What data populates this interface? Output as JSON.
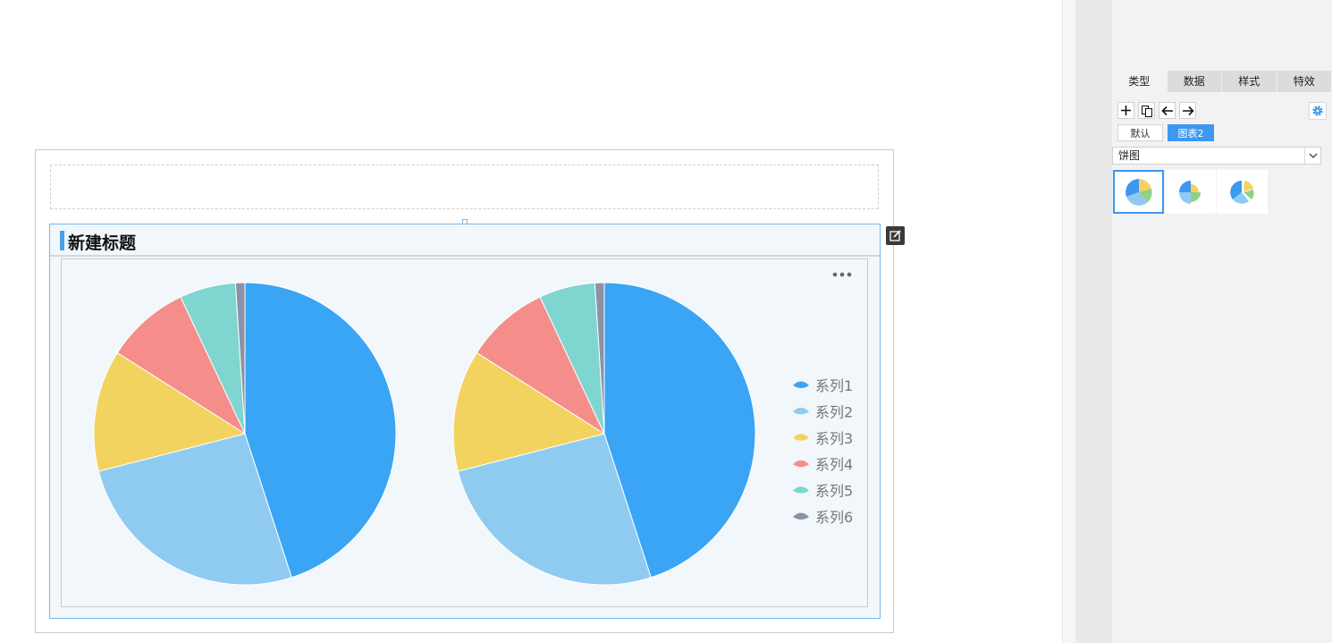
{
  "widget": {
    "title": "新建标题"
  },
  "panel": {
    "tabs": [
      "类型",
      "数据",
      "样式",
      "特效"
    ],
    "active_tab": "类型",
    "chips": {
      "default": "默认",
      "chart2": "图表2"
    },
    "select_value": "饼图",
    "accent_color": "#3c98f0"
  },
  "chart_data": {
    "type": "pie",
    "pies": [
      {
        "values": [
          45,
          26,
          13,
          9,
          6,
          1
        ]
      },
      {
        "values": [
          45,
          26,
          13,
          9,
          6,
          1
        ]
      }
    ],
    "series": [
      {
        "name": "系列1",
        "color": "#3aa4f5"
      },
      {
        "name": "系列2",
        "color": "#8fcbf1"
      },
      {
        "name": "系列3",
        "color": "#f3d35f"
      },
      {
        "name": "系列4",
        "color": "#f58e8b"
      },
      {
        "name": "系列5",
        "color": "#7fd5cf"
      },
      {
        "name": "系列6",
        "color": "#8a93a6"
      }
    ],
    "legend_position": "right"
  }
}
